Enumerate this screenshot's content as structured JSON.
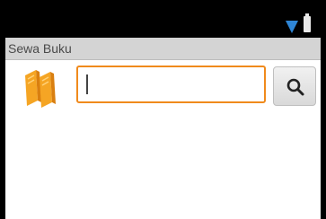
{
  "app": {
    "title": "Sewa Buku"
  },
  "status_bar": {
    "icons": [
      "wifi-icon",
      "battery-icon"
    ]
  },
  "search": {
    "value": "",
    "placeholder": "",
    "button_icon": "search-icon"
  },
  "header_icon": "books-icon",
  "colors": {
    "accent": "#f08a1c",
    "status_bar": "#000000",
    "action_bar": "#d4d4d4",
    "wifi": "#2f86d6"
  }
}
